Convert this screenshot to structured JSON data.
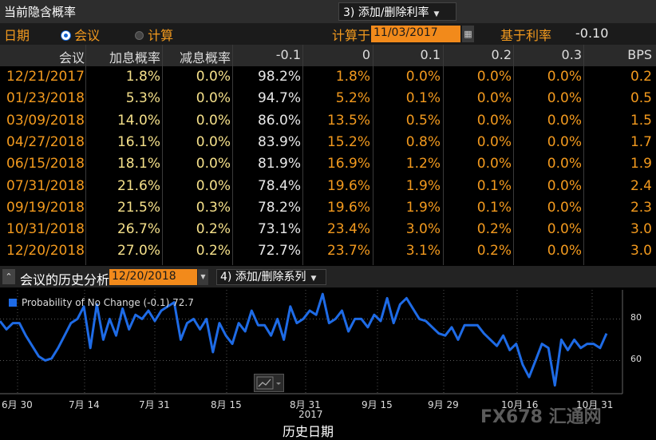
{
  "header": {
    "title": "当前隐含概率",
    "action_menu": "3) 添加/删除利率"
  },
  "options": {
    "date_label": "日期",
    "radio_meeting": "会议",
    "radio_calc": "计算",
    "calc_label": "计算于",
    "calc_date": "11/03/2017",
    "base_rate_label": "基于利率",
    "base_rate_value": "-0.10"
  },
  "table": {
    "columns": [
      "会议",
      "加息概率",
      "减息概率",
      "-0.1",
      "0",
      "0.1",
      "0.2",
      "0.3",
      "BPS"
    ],
    "rows": [
      [
        "12/21/2017",
        "1.8%",
        "0.0%",
        "98.2%",
        "1.8%",
        "0.0%",
        "0.0%",
        "0.0%",
        "0.2"
      ],
      [
        "01/23/2018",
        "5.3%",
        "0.0%",
        "94.7%",
        "5.2%",
        "0.1%",
        "0.0%",
        "0.0%",
        "0.5"
      ],
      [
        "03/09/2018",
        "14.0%",
        "0.0%",
        "86.0%",
        "13.5%",
        "0.5%",
        "0.0%",
        "0.0%",
        "1.5"
      ],
      [
        "04/27/2018",
        "16.1%",
        "0.0%",
        "83.9%",
        "15.2%",
        "0.8%",
        "0.0%",
        "0.0%",
        "1.7"
      ],
      [
        "06/15/2018",
        "18.1%",
        "0.0%",
        "81.9%",
        "16.9%",
        "1.2%",
        "0.0%",
        "0.0%",
        "1.9"
      ],
      [
        "07/31/2018",
        "21.6%",
        "0.0%",
        "78.4%",
        "19.6%",
        "1.9%",
        "0.1%",
        "0.0%",
        "2.4"
      ],
      [
        "09/19/2018",
        "21.5%",
        "0.3%",
        "78.2%",
        "19.6%",
        "1.9%",
        "0.1%",
        "0.0%",
        "2.3"
      ],
      [
        "10/31/2018",
        "26.7%",
        "0.2%",
        "73.1%",
        "23.4%",
        "3.0%",
        "0.2%",
        "0.0%",
        "3.0"
      ],
      [
        "12/20/2018",
        "27.0%",
        "0.2%",
        "72.7%",
        "23.7%",
        "3.1%",
        "0.2%",
        "0.0%",
        "3.0"
      ]
    ]
  },
  "history": {
    "label": "会议的历史分析",
    "date": "12/20/2018",
    "series_menu": "4) 添加/删除系列",
    "xaxis_title": "历史日期",
    "year_label": "2017"
  },
  "watermark": "FX678 汇通网",
  "colors": {
    "accent_orange": "#f39a1e",
    "value_yellow": "#f5e08a",
    "line_blue": "#1e6be6"
  },
  "chart_data": {
    "type": "line",
    "series": [
      {
        "name": "Probability of No Change (-0.1) 72.7",
        "values": [
          79,
          75,
          78,
          78,
          72,
          67,
          62,
          60,
          61,
          66,
          72,
          78,
          80,
          86,
          66,
          87,
          70,
          80,
          72,
          85,
          75,
          82,
          80,
          84,
          79,
          84,
          86,
          88,
          70,
          78,
          80,
          75,
          80,
          64,
          78,
          72,
          68,
          78,
          74,
          84,
          77,
          77,
          72,
          80,
          70,
          86,
          78,
          80,
          84,
          82,
          92,
          78,
          80,
          84,
          74,
          80,
          80,
          76,
          82,
          79,
          90,
          78,
          87,
          90,
          85,
          80,
          79,
          76,
          73,
          72,
          76,
          70,
          77,
          77,
          77,
          73,
          70,
          67,
          72,
          65,
          68,
          58,
          52,
          60,
          68,
          66,
          48,
          70,
          65,
          70,
          66,
          68,
          68,
          66,
          73
        ]
      }
    ],
    "x_tick_labels": [
      "6月 30",
      "7月 14",
      "7月 31",
      "8月 15",
      "8月 31",
      "9月 15",
      "9月 29",
      "10月 16",
      "10月 31"
    ],
    "x_sublabel": "2017",
    "xlabel": "历史日期",
    "ylabel": "",
    "y_ticks": [
      60,
      80
    ],
    "ylim": [
      44,
      94
    ],
    "grid": true,
    "legend": "top-left"
  }
}
